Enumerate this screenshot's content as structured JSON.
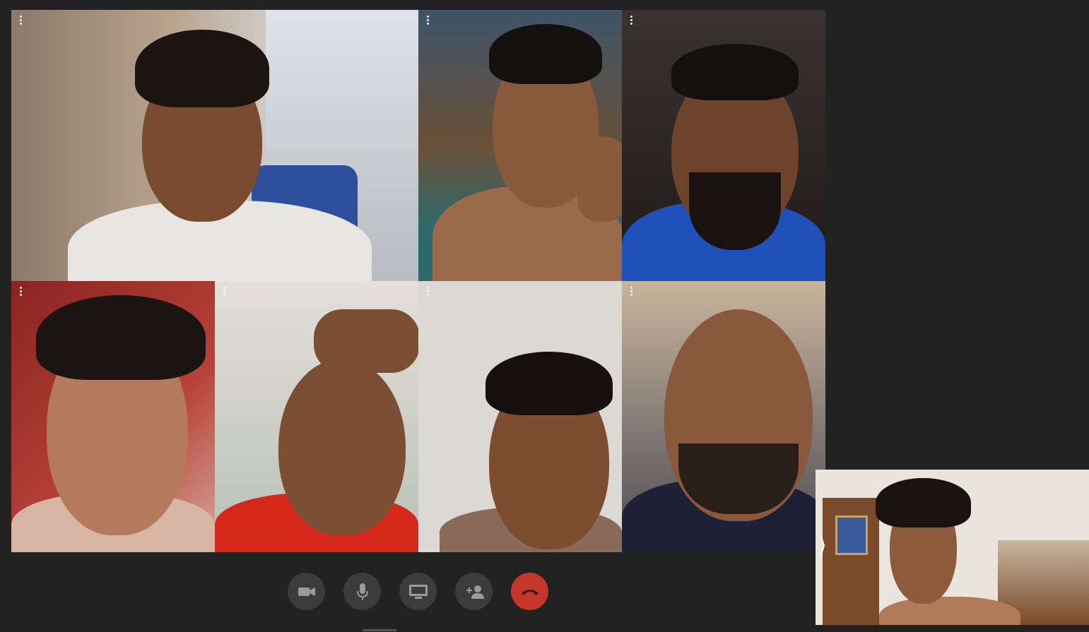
{
  "participants": [
    {
      "id": "p1",
      "bg": "#b9a48e",
      "skin": "#7a4a30",
      "hair": "#1c1410",
      "shirt": "#e8e6e2"
    },
    {
      "id": "p2",
      "bg": "#3d5468",
      "skin": "#8a5a3c",
      "hair": "#151010",
      "shirt": "#9b6a48"
    },
    {
      "id": "p3",
      "bg": "#2c2624",
      "skin": "#6e432c",
      "hair": "#141010",
      "shirt": "#1f4fb8"
    },
    {
      "id": "p4",
      "bg": "#a0302c",
      "skin": "#b37a5c",
      "hair": "#1a1412",
      "shirt": "#d7b4a4"
    },
    {
      "id": "p5",
      "bg": "#d8d2cc",
      "skin": "#7c4e34",
      "hair": "#1a1412",
      "shirt": "#d6281a"
    },
    {
      "id": "p6",
      "bg": "#dcd8d4",
      "skin": "#7e4c30",
      "hair": "#161010",
      "shirt": "#8a6a58"
    },
    {
      "id": "p7",
      "bg": "#3a3a44",
      "skin": "#8a583c",
      "hair": "#2a1e18",
      "shirt": "#1e2036"
    }
  ],
  "controls": {
    "camera": {
      "icon": "video-camera-icon"
    },
    "microphone": {
      "icon": "microphone-icon"
    },
    "screen_share": {
      "icon": "monitor-icon"
    },
    "add_person": {
      "icon": "add-person-icon"
    },
    "end_call": {
      "icon": "phone-hangup-icon",
      "color": "#c5362a"
    }
  },
  "self_view": {
    "expand_glyph": "⟩",
    "bg": "#e9e5dc",
    "skin": "#8d5a3c",
    "hair": "#181210"
  }
}
